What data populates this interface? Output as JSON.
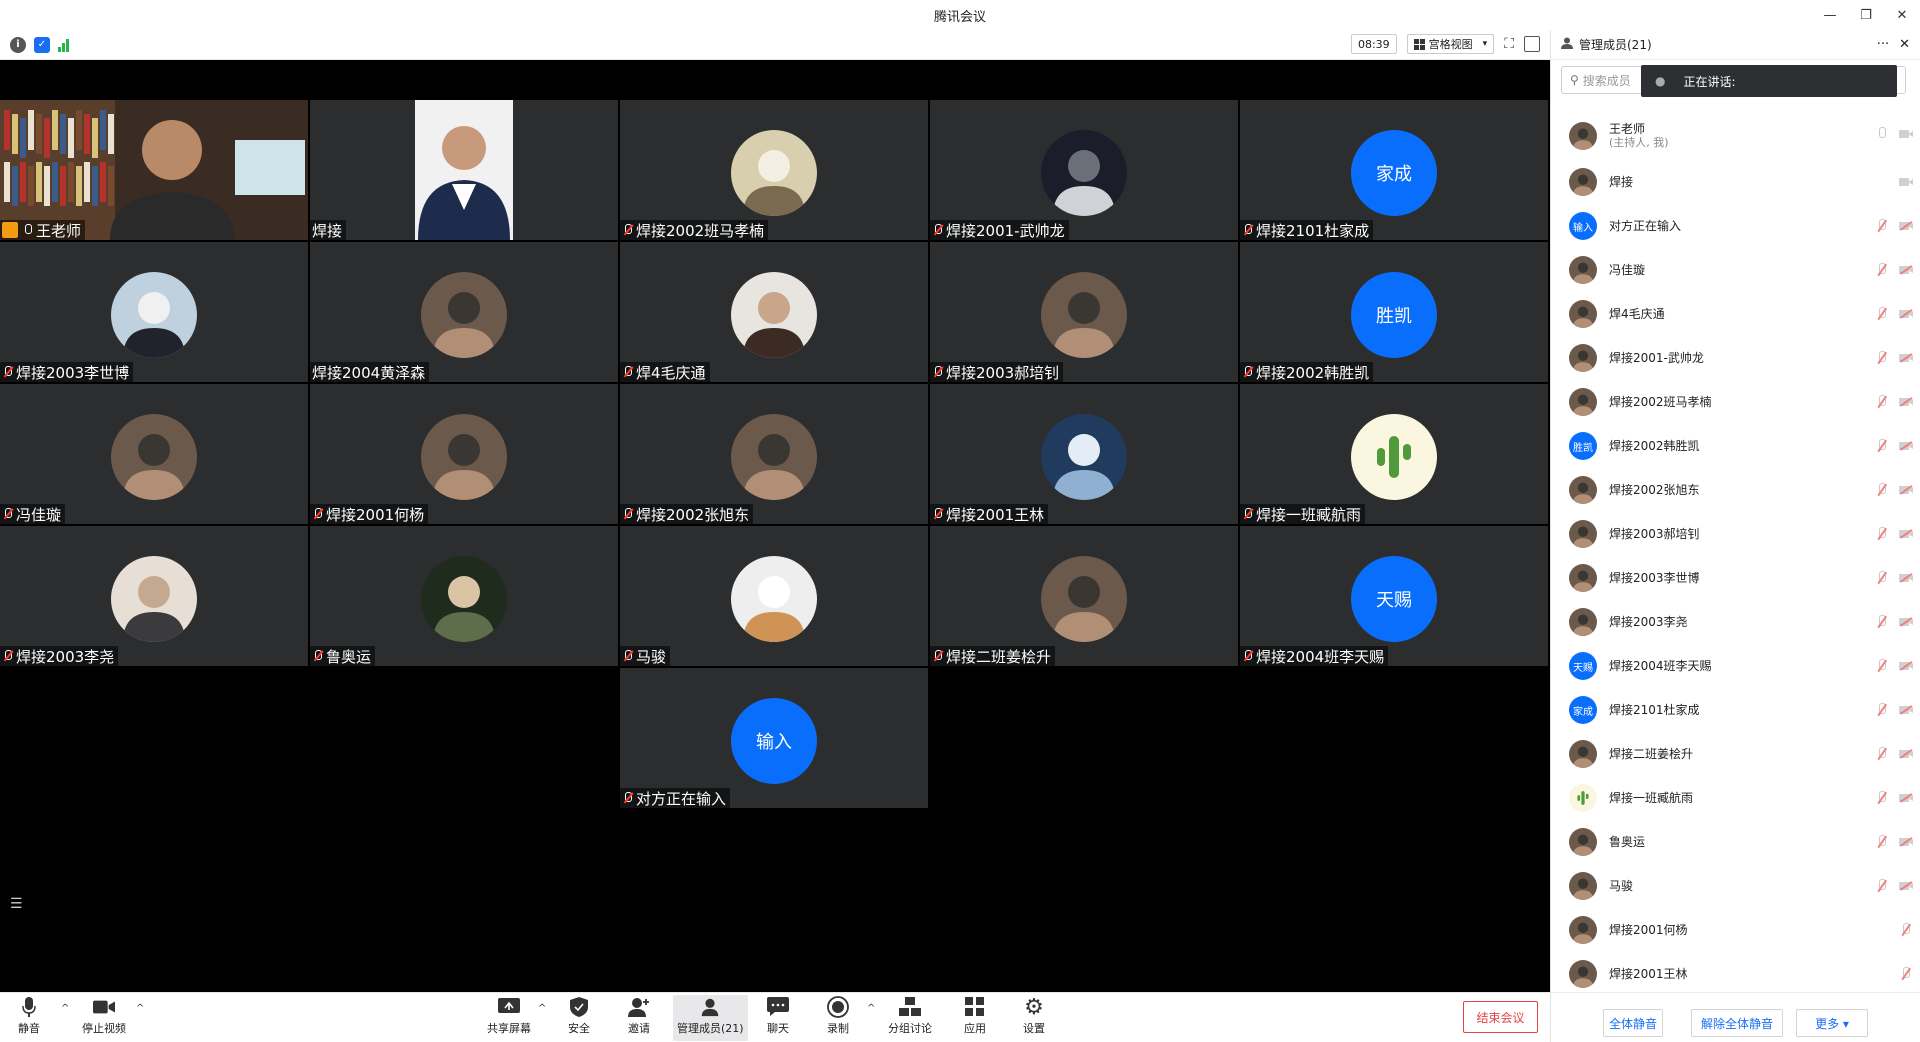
{
  "window": {
    "title": "腾讯会议",
    "min": "—",
    "restore": "❐",
    "close": "✕"
  },
  "statusbar": {
    "timer": "08:39",
    "view_label": "宫格视图",
    "view_caret": "▾"
  },
  "tiles": [
    {
      "name": "王老师",
      "type": "video"
    },
    {
      "name": "焊接",
      "type": "video"
    },
    {
      "name": "焊接2002班马孝楠",
      "avatar": "art"
    },
    {
      "name": "焊接2001-武帅龙",
      "avatar": "astronaut"
    },
    {
      "name": "焊接2101杜家成",
      "avatar_text": "家成"
    },
    {
      "name": "焊接2003李世博",
      "avatar": "anime"
    },
    {
      "name": "焊接2004黄泽森",
      "avatar": "photo"
    },
    {
      "name": "焊4毛庆通",
      "avatar": "beard"
    },
    {
      "name": "焊接2003郝培钊",
      "avatar": "photo"
    },
    {
      "name": "焊接2002韩胜凯",
      "avatar_text": "胜凯"
    },
    {
      "name": "冯佳璇",
      "avatar": "photo"
    },
    {
      "name": "焊接2001何杨",
      "avatar": "photo"
    },
    {
      "name": "焊接2002张旭东",
      "avatar": "photo"
    },
    {
      "name": "焊接2001王林",
      "avatar": "cartoon"
    },
    {
      "name": "焊接一班臧航雨",
      "avatar": "cactus"
    },
    {
      "name": "焊接2003李尧",
      "avatar": "cat"
    },
    {
      "name": "鲁奥运",
      "avatar": "soldier"
    },
    {
      "name": "马骏",
      "avatar": "dog"
    },
    {
      "name": "焊接二班姜桧升",
      "avatar": "photo"
    },
    {
      "name": "焊接2004班李天赐",
      "avatar_text": "天赐"
    },
    {
      "name": "对方正在输入",
      "avatar_text": "输入"
    }
  ],
  "toolbar": {
    "mute": "静音",
    "stop_video": "停止视频",
    "share": "共享屏幕",
    "security": "安全",
    "invite": "邀请",
    "members": "管理成员(21)",
    "chat": "聊天",
    "record": "录制",
    "breakout": "分组讨论",
    "apps": "应用",
    "settings": "设置",
    "end": "结束会议",
    "caret": "^"
  },
  "panel": {
    "title": "管理成员(21)",
    "more": "···",
    "close": "✕",
    "search_placeholder": "搜索成员",
    "speaking": "正在讲话:",
    "members": [
      {
        "name": "王老师",
        "sub": "(主持人, 我)",
        "avatar": "photo",
        "mic": "on",
        "cam": "on"
      },
      {
        "name": "焊接",
        "avatar": "photo",
        "cam": "on"
      },
      {
        "name": "对方正在输入",
        "avatar_text": "输入",
        "mic": "off",
        "cam": "off"
      },
      {
        "name": "冯佳璇",
        "avatar": "photo",
        "mic": "off",
        "cam": "off"
      },
      {
        "name": "焊4毛庆通",
        "avatar": "photo",
        "mic": "off",
        "cam": "off"
      },
      {
        "name": "焊接2001-武帅龙",
        "avatar": "photo",
        "mic": "off",
        "cam": "off"
      },
      {
        "name": "焊接2002班马孝楠",
        "avatar": "photo",
        "mic": "off",
        "cam": "off"
      },
      {
        "name": "焊接2002韩胜凯",
        "avatar_text": "胜凯",
        "mic": "off",
        "cam": "off"
      },
      {
        "name": "焊接2002张旭东",
        "avatar": "photo",
        "mic": "off",
        "cam": "off"
      },
      {
        "name": "焊接2003郝培钊",
        "avatar": "photo",
        "mic": "off",
        "cam": "off"
      },
      {
        "name": "焊接2003李世博",
        "avatar": "photo",
        "mic": "off",
        "cam": "off"
      },
      {
        "name": "焊接2003李尧",
        "avatar": "photo",
        "mic": "off",
        "cam": "off"
      },
      {
        "name": "焊接2004班李天赐",
        "avatar_text": "天赐",
        "mic": "off",
        "cam": "off"
      },
      {
        "name": "焊接2101杜家成",
        "avatar_text": "家成",
        "mic": "off",
        "cam": "off"
      },
      {
        "name": "焊接二班姜桧升",
        "avatar": "photo",
        "mic": "off",
        "cam": "off"
      },
      {
        "name": "焊接一班臧航雨",
        "avatar": "cactus",
        "mic": "off",
        "cam": "off"
      },
      {
        "name": "鲁奥运",
        "avatar": "photo",
        "mic": "off",
        "cam": "off"
      },
      {
        "name": "马骏",
        "avatar": "photo",
        "mic": "off",
        "cam": "off"
      },
      {
        "name": "焊接2001何杨",
        "avatar": "photo",
        "mic": "off"
      },
      {
        "name": "焊接2001王林",
        "avatar": "photo",
        "mic": "off"
      }
    ],
    "mute_all": "全体静音",
    "unmute_all": "解除全体静音",
    "more_btn": "更多 ▾"
  },
  "colors": {
    "accent": "#0a6efc",
    "danger": "#e54545",
    "tile_bg": "#2c2d2f"
  }
}
